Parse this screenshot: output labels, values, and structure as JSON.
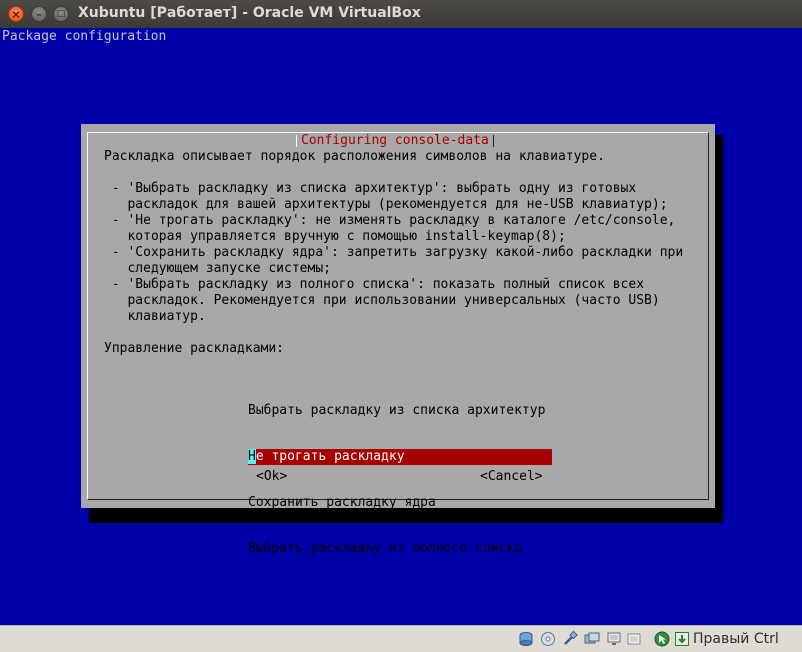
{
  "window": {
    "title": "Xubuntu [Работает] - Oracle VM VirtualBox",
    "close_glyph": "×",
    "minimize_glyph": "–",
    "maximize_glyph": "□"
  },
  "console": {
    "backtitle": "Package configuration",
    "dialog": {
      "title": "Configuring console-data",
      "description": "Раскладка описывает порядок расположения символов на клавиатуре.\n\n - 'Выбрать раскладку из списка архитектур': выбрать одну из готовых\n   раскладок для вашей архитектуры (рекомендуется для не-USB клавиатур);\n - 'Не трогать раскладку': не изменять раскладку в каталоге /etc/console,\n   которая управляется вручную с помощью install-keymap(8);\n - 'Сохранить раскладку ядра': запретить загрузку какой-либо раскладки при\n   следующем запуске системы;\n - 'Выбрать раскладку из полного списка': показать полный список всех\n   раскладок. Рекомендуется при использовании универсальных (часто USB)\n   клавиатур.\n\nУправление раскладками:",
      "options": [
        "Выбрать раскладку из списка архитектур",
        "Не трогать раскладку",
        "Сохранить раскладку ядра",
        "Выбрать раскладку из полного списка"
      ],
      "selected_option_cursor_char": "Н",
      "selected_option_rest": "е трогать раскладку",
      "ok_label": "<Ok>",
      "cancel_label": "<Cancel>"
    }
  },
  "statusbar": {
    "icons": [
      "hard-disk-icon",
      "optical-drive-icon",
      "usb-icon",
      "shared-folders-icon",
      "network-icon",
      "video-capture-icon",
      "mouse-integration-icon",
      "keyboard-capture-icon"
    ],
    "host_key_label": "Правый Ctrl"
  },
  "colors": {
    "console_background": "#0000a8",
    "dialog_background": "#a8a8a8",
    "dialog_title": "#a80000",
    "selection": "#a80000",
    "cursor": "#5ff0f0"
  }
}
